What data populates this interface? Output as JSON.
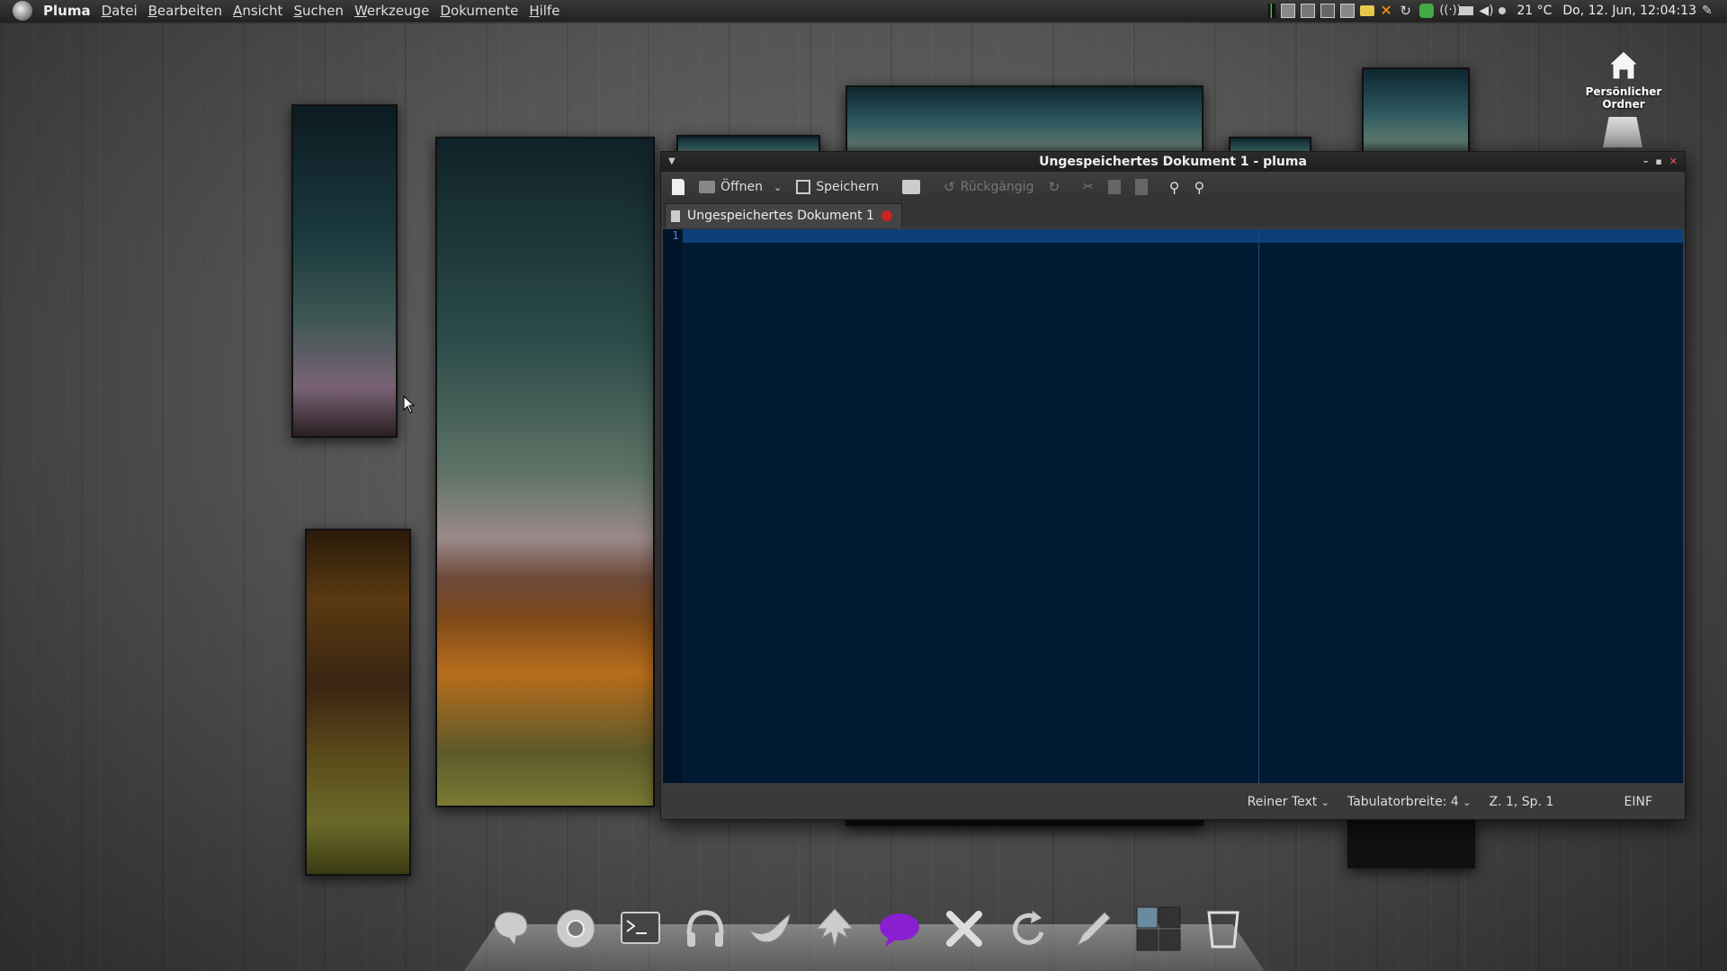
{
  "top_panel": {
    "app_name": "Pluma",
    "menus": [
      "Datei",
      "Bearbeiten",
      "Ansicht",
      "Suchen",
      "Werkzeuge",
      "Dokumente",
      "Hilfe"
    ],
    "temperature": "21 °C",
    "clock": "Do, 12. Jun, 12:04:13"
  },
  "desktop": {
    "home_label": "Persönlicher Ordner"
  },
  "window": {
    "title": "Ungespeichertes Dokument 1 - pluma",
    "toolbar": {
      "open_label": "Öffnen",
      "save_label": "Speichern",
      "undo_label": "Rückgängig"
    },
    "tab_label": "Ungespeichertes Dokument 1",
    "editor": {
      "line_numbers": [
        "1"
      ],
      "content": ""
    },
    "statusbar": {
      "language": "Reiner Text",
      "tab_width": "Tabulatorbreite: 4",
      "position": "Z. 1, Sp. 1",
      "mode": "EINF"
    }
  },
  "colors": {
    "editor_bg": "#001b33",
    "current_line": "#0c3f78",
    "panel_bg": "#222222"
  },
  "dock": {
    "items": [
      "pidgin-icon",
      "chromium-icon",
      "terminal-icon",
      "audio-icon",
      "thunderbird-icon",
      "inkscape-icon",
      "chat-icon",
      "x-tools-icon",
      "update-icon",
      "editor-pen-icon",
      "workspace-switcher-icon",
      "trash-icon"
    ]
  }
}
